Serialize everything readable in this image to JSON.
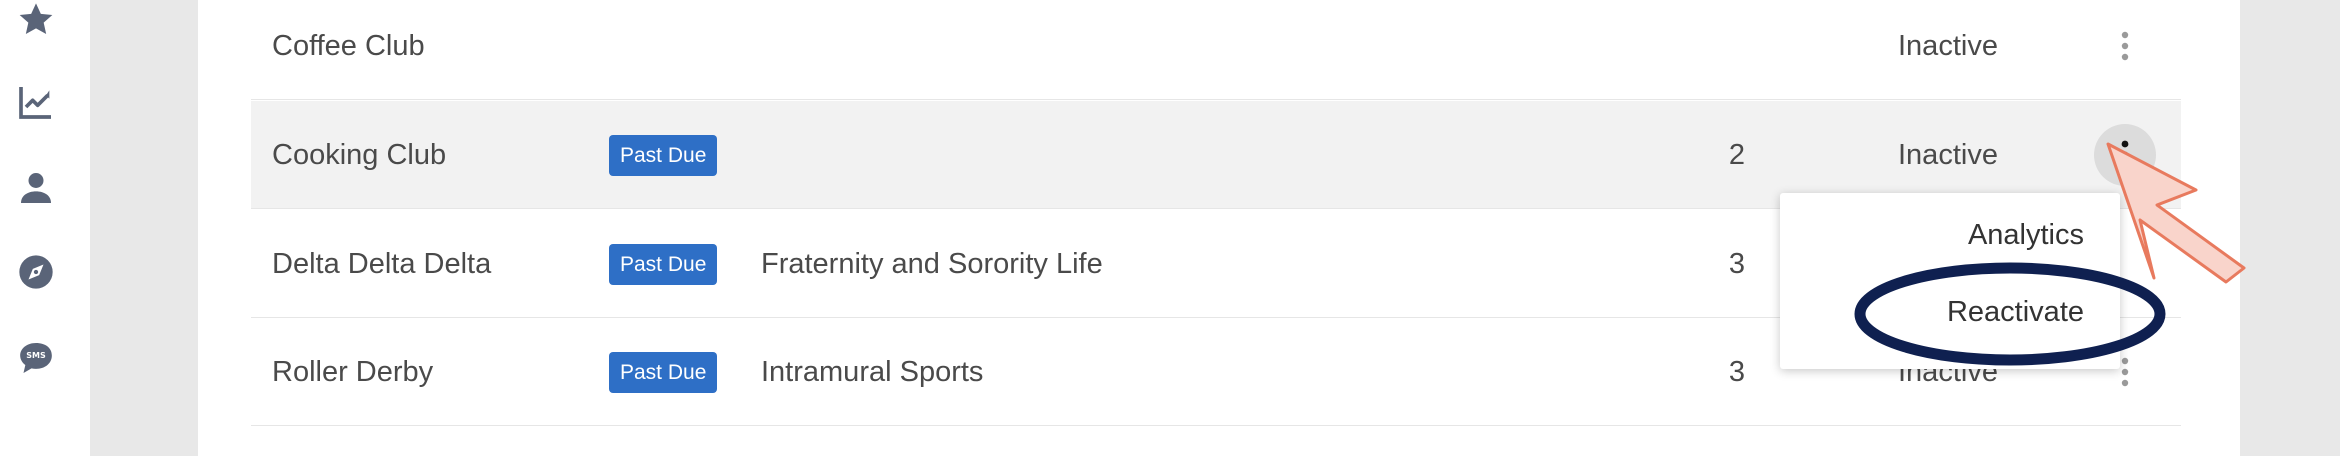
{
  "sidebar": {
    "items": [
      {
        "icon": "star-icon"
      },
      {
        "icon": "trending-chart-icon"
      },
      {
        "icon": "person-icon"
      },
      {
        "icon": "compass-icon"
      },
      {
        "icon": "sms-bubble-icon",
        "label": "SMS"
      }
    ]
  },
  "rows": [
    {
      "name": "Coffee Club",
      "badge": "",
      "category": "",
      "count": "",
      "status": "Inactive"
    },
    {
      "name": "Cooking Club",
      "badge": "Past Due",
      "category": "",
      "count": "2",
      "status": "Inactive"
    },
    {
      "name": "Delta Delta Delta",
      "badge": "Past Due",
      "category": "Fraternity and Sorority Life",
      "count": "3",
      "status": ""
    },
    {
      "name": "Roller Derby",
      "badge": "Past Due",
      "category": "Intramural Sports",
      "count": "3",
      "status": "Inactive"
    }
  ],
  "menu": {
    "items": [
      "Analytics",
      "Reactivate"
    ]
  },
  "colors": {
    "badge": "#2e6fc6",
    "annotation_ring": "#0f2050",
    "pointer_fill": "#f9d4cb",
    "pointer_stroke": "#e87a5e"
  }
}
